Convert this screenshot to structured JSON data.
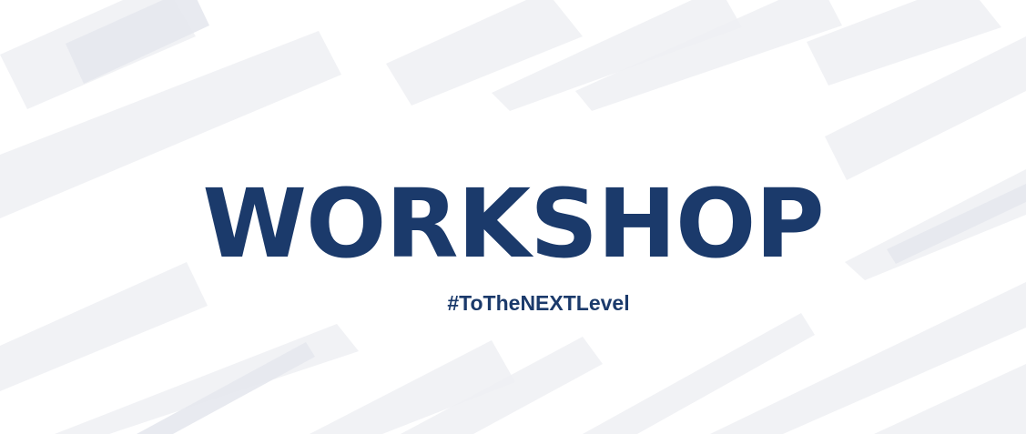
{
  "banner": {
    "title": "WORKSHOP",
    "tagline": "#ToTheNEXTLevel"
  },
  "colors": {
    "text": "#1b3a6b",
    "background": "#ffffff",
    "stripe": "#eef0f3"
  }
}
